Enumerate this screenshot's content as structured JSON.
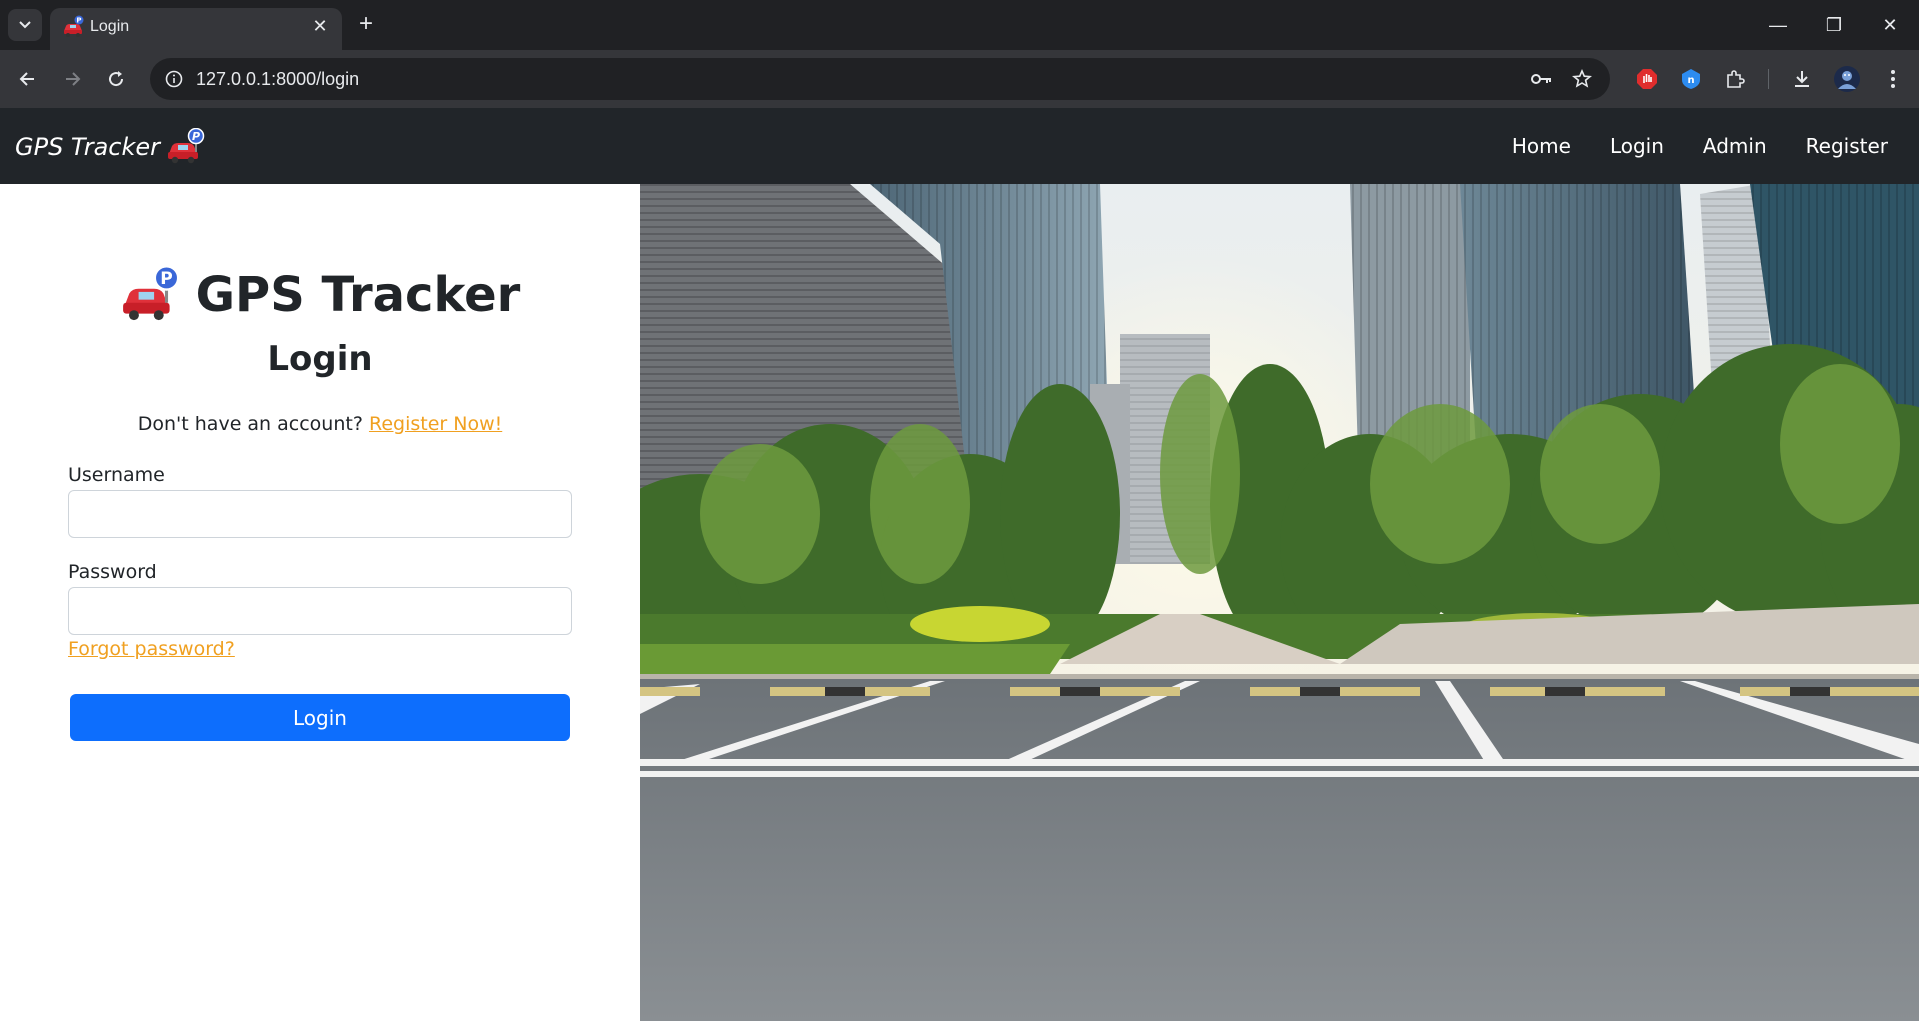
{
  "browser": {
    "tab_title": "Login",
    "url": "127.0.0.1:8000/login",
    "tab_close_glyph": "✕",
    "new_tab_glyph": "+",
    "minimize_glyph": "—",
    "restore_glyph": "❐",
    "close_glyph": "✕"
  },
  "navbar": {
    "brand": "GPS Tracker",
    "links": [
      "Home",
      "Login",
      "Admin",
      "Register"
    ]
  },
  "login": {
    "heading": "GPS Tracker",
    "title": "Login",
    "register_prompt": "Don't have an account?",
    "register_link": "Register Now!",
    "username_label": "Username",
    "username_value": "",
    "password_label": "Password",
    "password_value": "",
    "forgot_link": "Forgot password?",
    "submit_label": "Login"
  },
  "colors": {
    "navbar_bg": "#212529",
    "primary_button": "#0d6efd",
    "link_orange": "#f0a020"
  },
  "icons": [
    "tab-search-icon",
    "car-parking-icon",
    "back-icon",
    "forward-icon",
    "reload-icon",
    "site-info-icon",
    "password-key-icon",
    "bookmark-star-icon",
    "extension-icon",
    "download-icon",
    "profile-avatar-icon",
    "more-menu-icon"
  ]
}
